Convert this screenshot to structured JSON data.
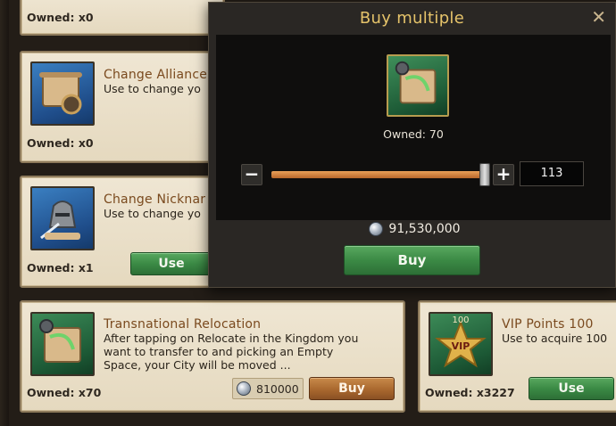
{
  "items": [
    {
      "owned": "Owned: x0"
    },
    {
      "title": "Change Alliance",
      "desc": "Use to change yo",
      "owned": "Owned: x0"
    },
    {
      "title": "Change Nicknar",
      "desc": "Use to change yo",
      "owned": "Owned: x1",
      "use_label": "Use"
    },
    {
      "title": "Transnational Relocation",
      "desc": "After tapping on Relocate in the Kingdom you\nwant to transfer to and picking an Empty\nSpace, your City will be moved ...",
      "owned": "Owned: x70",
      "price": "810000",
      "buy_label": "Buy"
    },
    {
      "badge": "100",
      "badge_text": "VIP",
      "title": "VIP Points 100",
      "desc": "Use to acquire 100",
      "owned": "Owned: x3227",
      "use_label": "Use"
    }
  ],
  "modal": {
    "title": "Buy multiple",
    "close_glyph": "✕",
    "owned": "Owned: 70",
    "minus_glyph": "−",
    "plus_glyph": "+",
    "quantity": "113",
    "slider_fraction": 0.98,
    "cost": "91,530,000",
    "buy_label": "Buy"
  },
  "colors": {
    "title_gold": "#e5c36a",
    "item_title_brown": "#7a4a1e",
    "green_button": "#3b8a45",
    "orange_button": "#a9682f"
  }
}
